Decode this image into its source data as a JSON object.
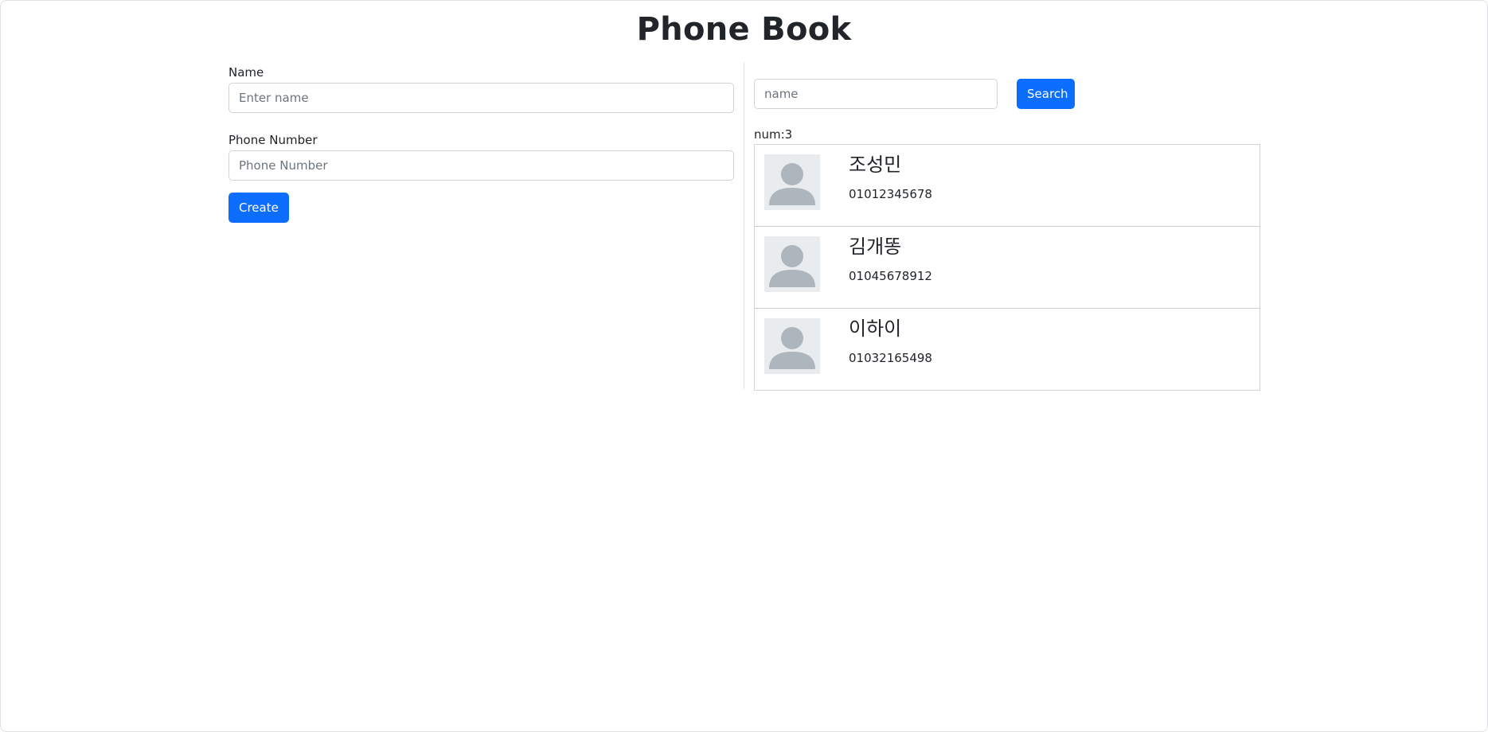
{
  "page": {
    "title": "Phone Book"
  },
  "form": {
    "name_label": "Name",
    "name_placeholder": "Enter name",
    "name_value": "",
    "phone_label": "Phone Number",
    "phone_placeholder": "Phone Number",
    "phone_value": "",
    "create_label": "Create"
  },
  "search": {
    "placeholder": "name",
    "value": "",
    "button_label": "Search"
  },
  "list": {
    "count_text": "num:3",
    "items": [
      {
        "name": "조성민",
        "phone": "01012345678",
        "avatar_icon": "person-icon"
      },
      {
        "name": "김개똥",
        "phone": "01045678912",
        "avatar_icon": "person-icon"
      },
      {
        "name": "이하이",
        "phone": "01032165498",
        "avatar_icon": "person-icon"
      }
    ]
  },
  "colors": {
    "primary": "#0d6efd",
    "avatar_bg": "#e9ecef",
    "avatar_fg": "#adb5bd",
    "border": "#dee2e6"
  }
}
